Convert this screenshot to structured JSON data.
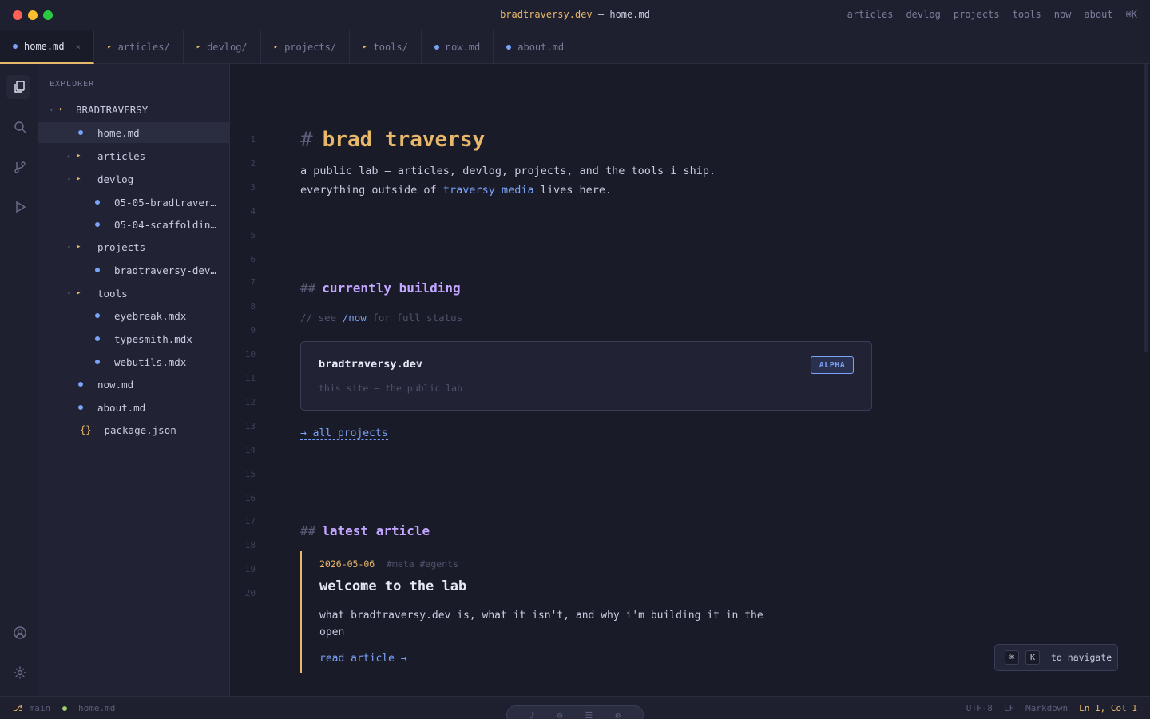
{
  "window": {
    "title_host": "bradtraversy.dev",
    "title_sep": " — ",
    "title_file": "home.md"
  },
  "topnav": [
    "articles",
    "devlog",
    "projects",
    "tools",
    "now",
    "about",
    "⌘K"
  ],
  "tabs": [
    {
      "label": "home.md",
      "kind": "file",
      "active": true,
      "close": "×"
    },
    {
      "label": "articles/",
      "kind": "folder"
    },
    {
      "label": "devlog/",
      "kind": "folder"
    },
    {
      "label": "projects/",
      "kind": "folder"
    },
    {
      "label": "tools/",
      "kind": "folder"
    },
    {
      "label": "now.md",
      "kind": "file"
    },
    {
      "label": "about.md",
      "kind": "file"
    }
  ],
  "activity_icons": [
    "files-icon",
    "search-icon",
    "git-branch-icon",
    "run-icon",
    "account-icon",
    "settings-icon"
  ],
  "sidebar": {
    "title": "EXPLORER",
    "root": "BRADTRAVERSY",
    "items": [
      {
        "label": "home.md"
      },
      {
        "label": "articles"
      },
      {
        "label": "devlog"
      },
      {
        "label": "05-05-bradtraver…"
      },
      {
        "label": "05-04-scaffoldin…"
      },
      {
        "label": "projects"
      },
      {
        "label": "bradtraversy-dev…"
      },
      {
        "label": "tools"
      },
      {
        "label": "eyebreak.mdx"
      },
      {
        "label": "typesmith.mdx"
      },
      {
        "label": "webutils.mdx"
      },
      {
        "label": "now.md"
      },
      {
        "label": "about.md"
      },
      {
        "label": "package.json"
      }
    ]
  },
  "editor": {
    "line_numbers": [
      "1",
      "2",
      "3",
      "4",
      "5",
      "6",
      "7",
      "8",
      "9",
      "10",
      "11",
      "12",
      "13",
      "14",
      "15",
      "16",
      "17",
      "18",
      "19",
      "20"
    ],
    "h1_hash": "#",
    "h1": "brad traversy",
    "intro_line1": "a public lab — articles, devlog, projects, and the tools i ship.",
    "intro_line2_pre": "everything outside of ",
    "intro_link": "traversy media",
    "intro_line2_post": " lives here.",
    "h2_hash": "##",
    "section1_title": "currently building",
    "comment_pre": "// see ",
    "comment_link": "/now",
    "comment_post": " for full status",
    "card": {
      "title": "bradtraversy.dev",
      "subtitle": "this site — the public lab",
      "badge": "ALPHA"
    },
    "all_projects": "→ all projects",
    "section2_title": "latest article",
    "article": {
      "date": "2026-05-06",
      "tags": "#meta #agents",
      "title": "welcome to the lab",
      "description": "what bradtraversy.dev is, what it isn't, and why i'm building it in the open",
      "read_link": "read article →"
    },
    "hint": {
      "key1": "⌘",
      "key2": "K",
      "label": "to navigate"
    }
  },
  "statusbar": {
    "branch_icon": "⎇",
    "branch": "main",
    "file": "home.md",
    "encoding": "UTF-8",
    "eol": "LF",
    "language": "Markdown",
    "position": "Ln 1, Col 1"
  },
  "colors": {
    "accent": "#e8b86a",
    "link": "#7aa2f7",
    "heading2": "#c3a6ff",
    "background": "#1a1b29"
  }
}
